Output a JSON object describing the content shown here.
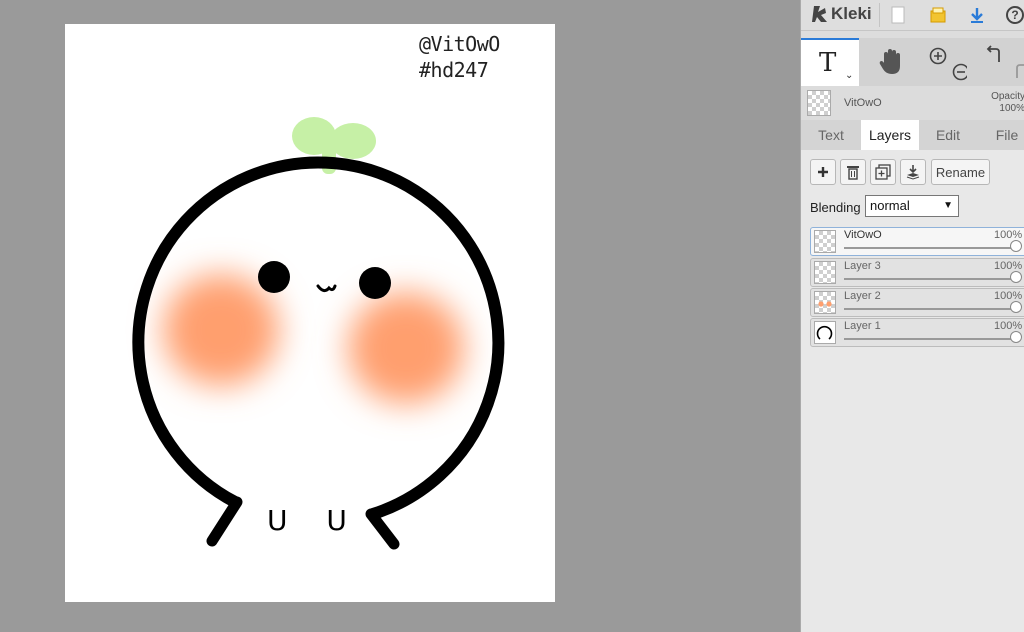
{
  "app": {
    "name": "Kleki"
  },
  "canvas": {
    "watermark_line1": "@VitOwO",
    "watermark_line2": "#hd247",
    "mouth_text": "U U",
    "colors": {
      "sprout": "#c6f0a6",
      "blush": "#ff9f6e",
      "outline": "#000000"
    }
  },
  "topbar": {
    "icons": [
      "kleki-logo-icon",
      "new-document-icon",
      "save-icon",
      "download-icon",
      "help-icon"
    ],
    "help_label": "?"
  },
  "tools": {
    "active_tool": "T",
    "active_tool_name": "text-tool-icon",
    "others": [
      "hand-tool-icon",
      "zoom-in-icon",
      "zoom-out-icon",
      "undo-icon",
      "redo-icon"
    ]
  },
  "current_layer": {
    "name": "VitOwO",
    "opacity_label": "Opacity",
    "opacity_value": "100%"
  },
  "tabs": [
    {
      "label": "Text",
      "active": false
    },
    {
      "label": "Layers",
      "active": true
    },
    {
      "label": "Edit",
      "active": false
    },
    {
      "label": "File",
      "active": false
    }
  ],
  "layers_panel": {
    "buttons": {
      "add": "add-layer-icon",
      "delete": "delete-layer-icon",
      "duplicate": "duplicate-layer-icon",
      "merge": "merge-down-icon",
      "rename_label": "Rename"
    },
    "blending_label": "Blending",
    "blending_value": "normal",
    "layers": [
      {
        "name": "VitOwO",
        "opacity": "100%",
        "active": true
      },
      {
        "name": "Layer 3",
        "opacity": "100%",
        "active": false
      },
      {
        "name": "Layer 2",
        "opacity": "100%",
        "active": false
      },
      {
        "name": "Layer 1",
        "opacity": "100%",
        "active": false
      }
    ]
  }
}
